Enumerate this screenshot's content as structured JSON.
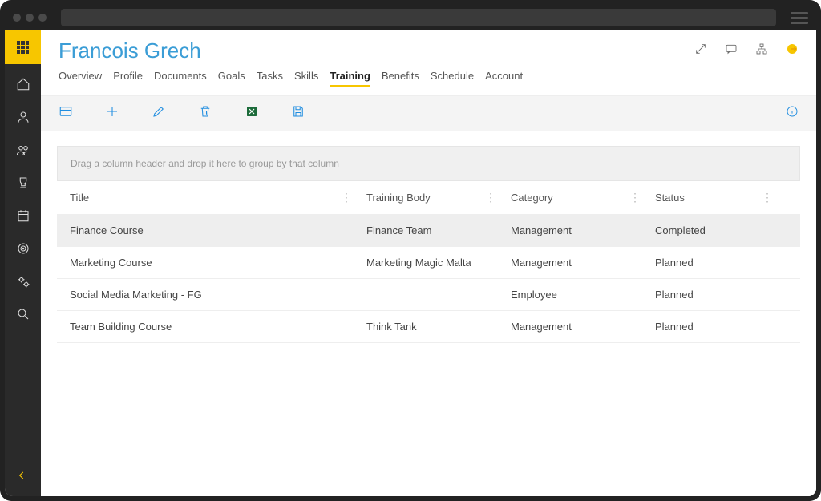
{
  "header": {
    "title": "Francois Grech"
  },
  "tabs": [
    {
      "id": "overview",
      "label": "Overview",
      "active": false
    },
    {
      "id": "profile",
      "label": "Profile",
      "active": false
    },
    {
      "id": "documents",
      "label": "Documents",
      "active": false
    },
    {
      "id": "goals",
      "label": "Goals",
      "active": false
    },
    {
      "id": "tasks",
      "label": "Tasks",
      "active": false
    },
    {
      "id": "skills",
      "label": "Skills",
      "active": false
    },
    {
      "id": "training",
      "label": "Training",
      "active": true
    },
    {
      "id": "benefits",
      "label": "Benefits",
      "active": false
    },
    {
      "id": "schedule",
      "label": "Schedule",
      "active": false
    },
    {
      "id": "account",
      "label": "Account",
      "active": false
    }
  ],
  "grid": {
    "group_hint": "Drag a column header and drop it here to group by that column",
    "columns": [
      "Title",
      "Training Body",
      "Category",
      "Status"
    ],
    "rows": [
      {
        "title": "Finance Course",
        "body": "Finance Team",
        "category": "Management",
        "status": "Completed",
        "selected": true
      },
      {
        "title": "Marketing Course",
        "body": "Marketing Magic Malta",
        "category": "Management",
        "status": "Planned",
        "selected": false
      },
      {
        "title": "Social Media Marketing - FG",
        "body": "",
        "category": "Employee",
        "status": "Planned",
        "selected": false
      },
      {
        "title": "Team Building Course",
        "body": "Think Tank",
        "category": "Management",
        "status": "Planned",
        "selected": false
      }
    ]
  }
}
